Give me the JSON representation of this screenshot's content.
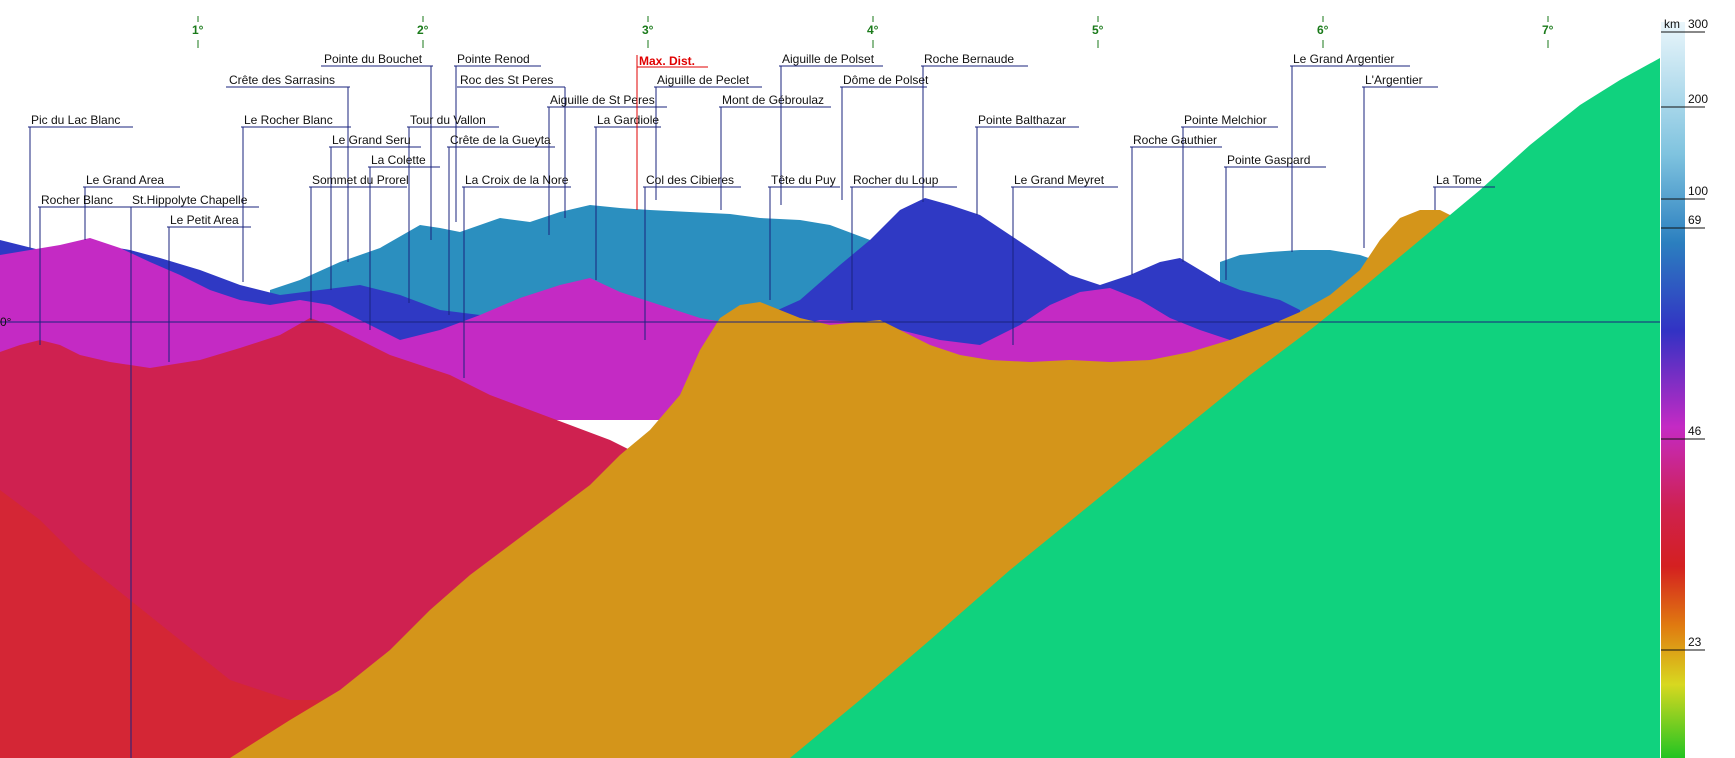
{
  "azimuth_ticks": [
    "1°",
    "2°",
    "3°",
    "4°",
    "5°",
    "6°",
    "7°"
  ],
  "horizon_marker": "0°",
  "distance_scale": {
    "unit": "km",
    "labels": [
      "300",
      "200",
      "100",
      "69",
      "46",
      "23"
    ]
  },
  "max_distance_label": "Max. Dist.",
  "peaks": [
    "Pic du Lac Blanc",
    "Crête des Sarrasins",
    "Pointe du Bouchet",
    "Pointe Renod",
    "Roc des St Peres",
    "Aiguille de Peclet",
    "Aiguille de Polset",
    "Roche Bernaude",
    "Dôme de Polset",
    "Aiguille de St Peres",
    "Mont de Gébroulaz",
    "La Gardiole",
    "Le Rocher Blanc",
    "Tour du Vallon",
    "Le Grand Seru",
    "Crête de la Gueyta",
    "La Colette",
    "Le Grand Area",
    "Sommet du Prorel",
    "La Croix de la Nore",
    "Col des Cibieres",
    "Tête du Puy",
    "Rocher du Loup",
    "Pointe Balthazar",
    "Le Grand Meyret",
    "Rocher Blanc",
    "St.Hippolyte Chapelle",
    "Le Petit Area",
    "Le Grand Argentier",
    "L'Argentier",
    "Pointe Melchior",
    "Roche Gauthier",
    "Pointe Gaspard",
    "La Tome"
  ],
  "colors": {
    "foreground_ridge": "#10d27e",
    "orange_ridge": "#d4951a",
    "crimson_ridge": "#cf2150",
    "magenta_ridge": "#c42ac4",
    "blue_ridge": "#2f39c4",
    "cyan_ridge": "#2b8fbf",
    "label_line": "#1a237e",
    "max_line": "#e00000",
    "tick_color": "#1a7a1a"
  }
}
